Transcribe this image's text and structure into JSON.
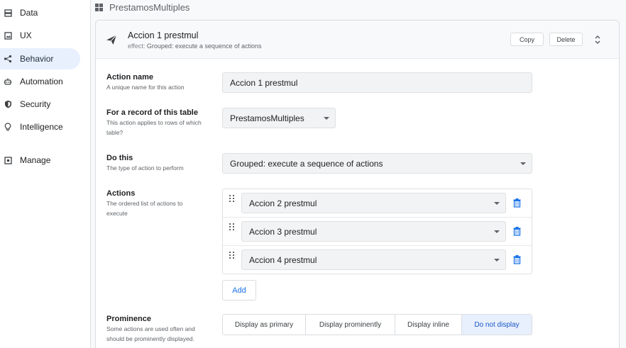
{
  "sidebar": {
    "items": [
      {
        "label": "Data",
        "icon": "data-icon",
        "active": false
      },
      {
        "label": "UX",
        "icon": "ux-icon",
        "active": false
      },
      {
        "label": "Behavior",
        "icon": "behavior-icon",
        "active": true
      },
      {
        "label": "Automation",
        "icon": "automation-icon",
        "active": false
      },
      {
        "label": "Security",
        "icon": "shield-icon",
        "active": false
      },
      {
        "label": "Intelligence",
        "icon": "lightbulb-icon",
        "active": false
      },
      {
        "label": "Manage",
        "icon": "manage-icon",
        "active": false
      }
    ]
  },
  "main": {
    "table_title": "PrestamosMultiples",
    "action": {
      "title": "Accion 1 prestmul",
      "effect_prefix": "effect:",
      "effect_value": "Grouped: execute a sequence of actions",
      "copy_label": "Copy",
      "delete_label": "Delete"
    },
    "fields": {
      "action_name": {
        "label": "Action name",
        "help": "A unique name for this action",
        "value": "Accion 1 prestmul"
      },
      "record_table": {
        "label": "For a record of this table",
        "help": "This action applies to rows of which table?",
        "value": "PrestamosMultiples"
      },
      "do_this": {
        "label": "Do this",
        "help": "The type of action to perform",
        "value": "Grouped: execute a sequence of actions"
      },
      "actions": {
        "label": "Actions",
        "help": "The ordered list of actions to execute",
        "items": [
          "Accion 2 prestmul",
          "Accion 3 prestmul",
          "Accion 4 prestmul"
        ],
        "add_label": "Add"
      },
      "prominence": {
        "label": "Prominence",
        "help": "Some actions are used often and should be prominently displayed.",
        "options": [
          "Display as primary",
          "Display prominently",
          "Display inline",
          "Do not display"
        ],
        "selected": "Do not display"
      }
    }
  },
  "colors": {
    "accent": "#1a73e8",
    "active_nav_bg": "#e8f0fe",
    "selected_option_bg": "#e8f0fe"
  }
}
